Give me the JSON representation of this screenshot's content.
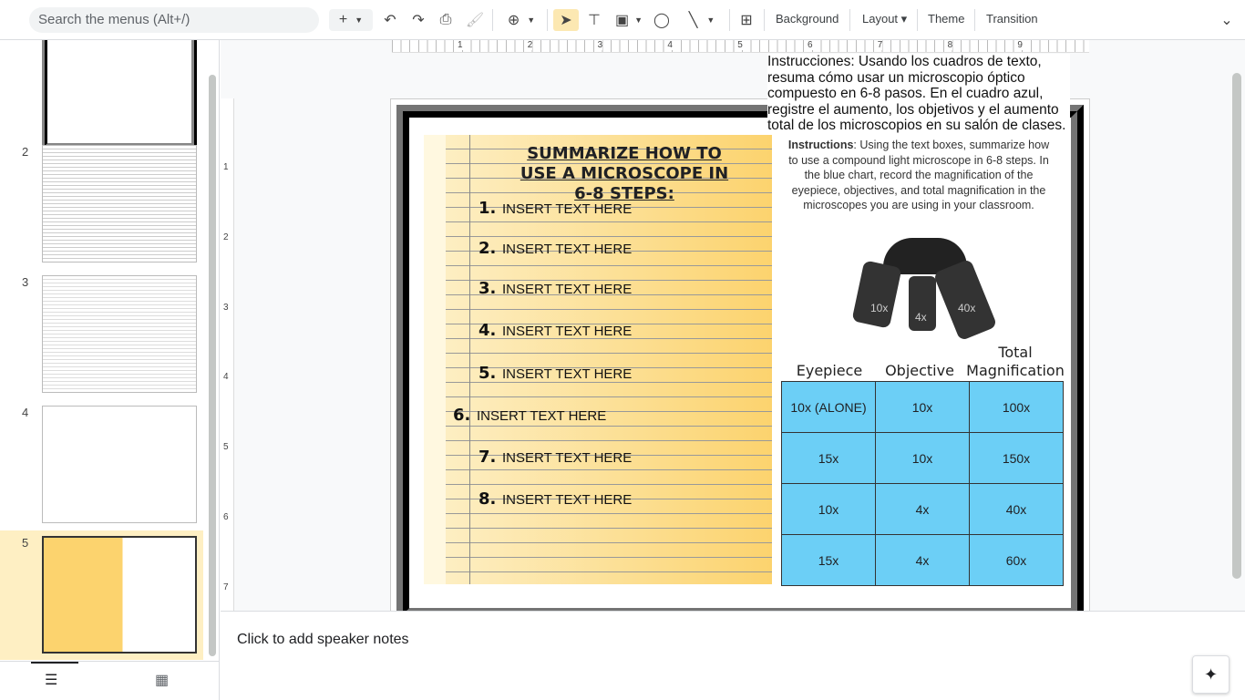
{
  "toolbar": {
    "search_placeholder": "Search the menus (Alt+/)",
    "background": "Background",
    "layout": "Layout",
    "theme": "Theme",
    "transition": "Transition"
  },
  "filmstrip": {
    "slides": [
      {
        "number": "2"
      },
      {
        "number": "3"
      },
      {
        "number": "4"
      },
      {
        "number": "5"
      }
    ]
  },
  "ruler": {
    "h": [
      "1",
      "2",
      "3",
      "4",
      "5",
      "6",
      "7",
      "8",
      "9"
    ],
    "v": [
      "1",
      "2",
      "3",
      "4",
      "5",
      "6",
      "7"
    ]
  },
  "slide": {
    "spanish_instructions": "Instrucciones: Usando los cuadros de texto, resuma cómo usar un microscopio óptico compuesto en 6-8 pasos. En el cuadro azul, registre el aumento, los objetivos y el aumento total de los microscopios en su salón de clases.",
    "title_underlined": "SUMMARIZE",
    "title_rest": " HOW TO USE A MICROSCOPE IN 6-8 STEPS:",
    "steps": [
      {
        "n": "1.",
        "t": "INSERT TEXT HERE"
      },
      {
        "n": "2.",
        "t": "INSERT TEXT HERE"
      },
      {
        "n": "3.",
        "t": "INSERT TEXT HERE"
      },
      {
        "n": "4.",
        "t": "INSERT TEXT HERE"
      },
      {
        "n": "5.",
        "t": "INSERT TEXT HERE"
      },
      {
        "n": "6.",
        "t": "INSERT TEXT HERE"
      },
      {
        "n": "7.",
        "t": "INSERT TEXT HERE"
      },
      {
        "n": "8.",
        "t": "INSERT TEXT HERE"
      }
    ],
    "instructions_label": "Instructions",
    "instructions": ": Using the text boxes, summarize how to use a compound light microscope in 6-8 steps. In the blue chart, record the magnification of the eyepiece, objectives, and total magnification in the microscopes you are using in your classroom.",
    "lens_labels": [
      "10x",
      "4x",
      "40x"
    ],
    "table_headers": [
      "Eyepiece",
      "Objective",
      "Total Magnification"
    ],
    "table_rows": [
      [
        "10x (ALONE)",
        "10x",
        "100x"
      ],
      [
        "15x",
        "10x",
        "150x"
      ],
      [
        "10x",
        "4x",
        "40x"
      ],
      [
        "15x",
        "4x",
        "60x"
      ]
    ]
  },
  "notes": {
    "placeholder": "Click to add speaker notes"
  }
}
